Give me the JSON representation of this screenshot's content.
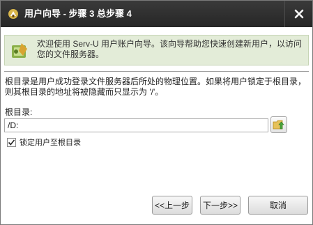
{
  "window": {
    "title": "用户向导 - 步骤 3 总步骤 4"
  },
  "banner": {
    "text": "欢迎使用 Serv-U 用户账户向导。该向导帮助您快速创建新用户，以访问您的文件服务器。",
    "icon": "wizard-icon"
  },
  "description": "根目录是用户成功登录文件服务器后所处的物理位置。如果将用户锁定于根目录，则其根目录的地址将被隐藏而只显示为 '/'。",
  "root_dir": {
    "label": "根目录:",
    "value": "/D:",
    "browse_icon": "folder-up-icon"
  },
  "lock_user": {
    "label": "锁定用户至根目录",
    "checked": true
  },
  "buttons": {
    "back": "<<上一步",
    "next": "下一步>>",
    "cancel": "取消"
  },
  "colors": {
    "titlebar": "#2e2e2e",
    "banner_bg": "#e3ecd8"
  }
}
